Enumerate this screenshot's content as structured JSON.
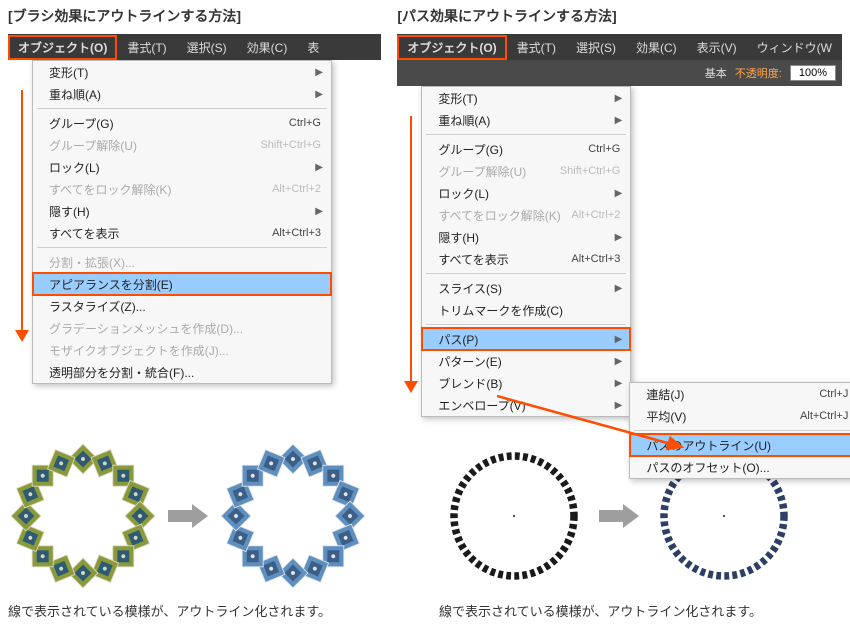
{
  "left": {
    "title": "[ブラシ効果にアウトラインする方法]",
    "menubar": [
      "オブジェクト(O)",
      "書式(T)",
      "選択(S)",
      "効果(C)",
      "表"
    ],
    "menu": [
      {
        "label": "変形(T)",
        "sub": true
      },
      {
        "label": "重ね順(A)",
        "sub": true
      },
      {
        "sep": true
      },
      {
        "label": "グループ(G)",
        "shortcut": "Ctrl+G"
      },
      {
        "label": "グループ解除(U)",
        "shortcut": "Shift+Ctrl+G",
        "disabled": true
      },
      {
        "label": "ロック(L)",
        "sub": true
      },
      {
        "label": "すべてをロック解除(K)",
        "shortcut": "Alt+Ctrl+2",
        "disabled": true
      },
      {
        "label": "隠す(H)",
        "sub": true
      },
      {
        "label": "すべてを表示",
        "shortcut": "Alt+Ctrl+3"
      },
      {
        "sep": true
      },
      {
        "label": "分割・拡張(X)...",
        "disabled": true
      },
      {
        "label": "アピアランスを分割(E)",
        "selected": true,
        "box": true
      },
      {
        "label": "ラスタライズ(Z)..."
      },
      {
        "label": "グラデーションメッシュを作成(D)...",
        "disabled": true
      },
      {
        "label": "モザイクオブジェクトを作成(J)...",
        "disabled": true
      },
      {
        "label": "透明部分を分割・統合(F)..."
      }
    ],
    "caption": "線で表示されている模様が、アウトライン化されます。"
  },
  "right": {
    "title": "[パス効果にアウトラインする方法]",
    "menubar": [
      "オブジェクト(O)",
      "書式(T)",
      "選択(S)",
      "効果(C)",
      "表示(V)",
      "ウィンドウ(W"
    ],
    "toolstrip": {
      "basic": "基本",
      "opacity_label": "不透明度:",
      "opacity_value": "100%"
    },
    "menu": [
      {
        "label": "変形(T)",
        "sub": true
      },
      {
        "label": "重ね順(A)",
        "sub": true
      },
      {
        "sep": true
      },
      {
        "label": "グループ(G)",
        "shortcut": "Ctrl+G"
      },
      {
        "label": "グループ解除(U)",
        "shortcut": "Shift+Ctrl+G",
        "disabled": true
      },
      {
        "label": "ロック(L)",
        "sub": true
      },
      {
        "label": "すべてをロック解除(K)",
        "shortcut": "Alt+Ctrl+2",
        "disabled": true
      },
      {
        "label": "隠す(H)",
        "sub": true
      },
      {
        "label": "すべてを表示",
        "shortcut": "Alt+Ctrl+3"
      },
      {
        "sep": true
      },
      {
        "label": "スライス(S)",
        "sub": true
      },
      {
        "label": "トリムマークを作成(C)"
      },
      {
        "sep": true
      },
      {
        "label": "パス(P)",
        "sub": true,
        "selected": true,
        "box": true
      },
      {
        "label": "パターン(E)",
        "sub": true
      },
      {
        "label": "ブレンド(B)",
        "sub": true
      },
      {
        "label": "エンベロープ(V)",
        "sub": true
      }
    ],
    "submenu": [
      {
        "label": "連結(J)",
        "shortcut": "Ctrl+J"
      },
      {
        "label": "平均(V)",
        "shortcut": "Alt+Ctrl+J"
      },
      {
        "sep": true
      },
      {
        "label": "パスのアウトライン(U)",
        "selected": true,
        "box": true
      },
      {
        "label": "パスのオフセット(O)..."
      }
    ],
    "caption": "線で表示されている模様が、アウトライン化されます。"
  }
}
